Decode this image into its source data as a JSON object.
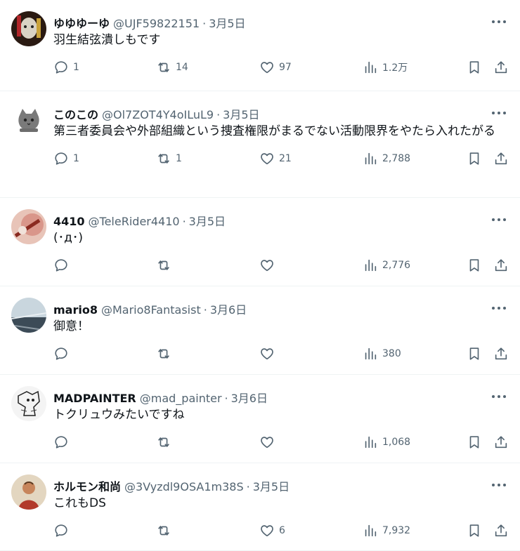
{
  "tweets": [
    {
      "name": "ゆゆゆーゆ",
      "handle": "@UJF59822151",
      "date": "3月5日",
      "text": "羽生結弦潰しもです",
      "replies": "1",
      "retweets": "14",
      "likes": "97",
      "views": "1.2万"
    },
    {
      "name": "このこの",
      "handle": "@Ol7ZOT4Y4oILuL9",
      "date": "3月5日",
      "text": "第三者委員会や外部組織という捜査権限がまるでない活動限界をやたら入れたがる",
      "replies": "1",
      "retweets": "1",
      "likes": "21",
      "views": "2,788"
    },
    {
      "name": "4410",
      "handle": "@TeleRider4410",
      "date": "3月5日",
      "text": "(･д･)",
      "replies": "",
      "retweets": "",
      "likes": "",
      "views": "2,776"
    },
    {
      "name": "mario8",
      "handle": "@Mario8Fantasist",
      "date": "3月6日",
      "text": "御意！",
      "replies": "",
      "retweets": "",
      "likes": "",
      "views": "380"
    },
    {
      "name": "MADPAINTER",
      "handle": "@mad_painter",
      "date": "3月6日",
      "text": "トクリュウみたいですね",
      "replies": "",
      "retweets": "",
      "likes": "",
      "views": "1,068"
    },
    {
      "name": "ホルモン和尚",
      "handle": "@3Vyzdl9OSA1m38S",
      "date": "3月5日",
      "text": "これもDS",
      "replies": "",
      "retweets": "",
      "likes": "6",
      "views": "7,932"
    }
  ],
  "separator": "·",
  "icons": [
    "more-icon",
    "reply-icon",
    "retweet-icon",
    "like-icon",
    "views-icon",
    "bookmark-icon",
    "share-icon"
  ],
  "colors": {
    "text": "#0f1419",
    "muted": "#536471",
    "border": "#eff3f4"
  }
}
